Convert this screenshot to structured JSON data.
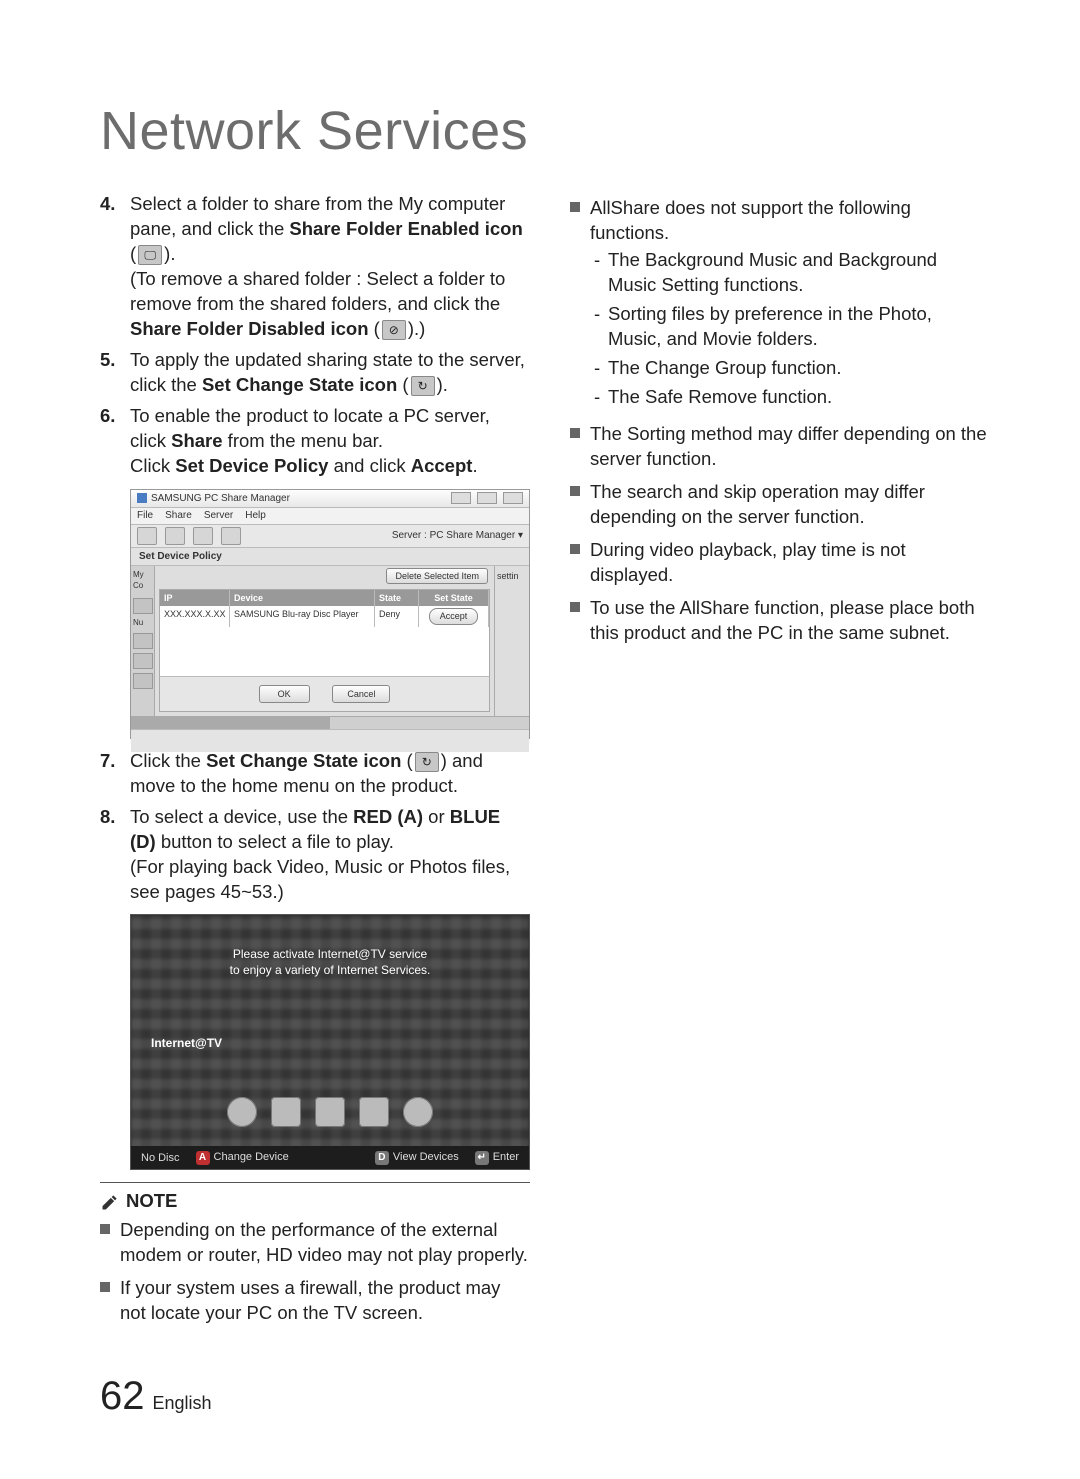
{
  "title": "Network Services",
  "steps": {
    "4": {
      "num": "4.",
      "text_a": "Select a folder to share from the My computer pane, and click the ",
      "bold_a": "Share Folder Enabled icon",
      "text_b": " (",
      "text_c": ").",
      "text_d": "(To remove a shared folder : Select a folder to remove from the shared folders, and click the ",
      "bold_b": "Share Folder Disabled icon",
      "text_e": " (",
      "text_f": ").)"
    },
    "5": {
      "num": "5.",
      "text_a": "To apply the updated sharing state to the server, click the ",
      "bold_a": "Set Change State icon",
      "text_b": " (",
      "text_c": ")."
    },
    "6": {
      "num": "6.",
      "text_a": "To enable the product to locate a PC server, click ",
      "bold_a": "Share",
      "text_b": " from the menu bar.",
      "text_c": "Click ",
      "bold_b": "Set Device Policy",
      "text_d": " and click ",
      "bold_c": "Accept",
      "text_e": "."
    },
    "7": {
      "num": "7.",
      "text_a": "Click the ",
      "bold_a": "Set Change State icon",
      "text_b": " (",
      "text_c": ") and move to the home menu on the product."
    },
    "8": {
      "num": "8.",
      "text_a": "To select a device, use the ",
      "bold_a": "RED (A)",
      "text_b": " or ",
      "bold_b": "BLUE (D)",
      "text_c": " button to select a file to play.",
      "text_d": "(For playing back Video, Music or Photos files, see pages 45~53.)"
    }
  },
  "window": {
    "title": "SAMSUNG PC Share Manager",
    "menus": [
      "File",
      "Share",
      "Server",
      "Help"
    ],
    "server_label": "Server : PC Share Manager ▾",
    "policy_label": "Set Device Policy",
    "myc_label": "My Co",
    "num_label": "Nu",
    "delete_btn": "Delete Selected Item",
    "headers": {
      "ip": "IP",
      "device": "Device",
      "state": "State",
      "set": "Set State"
    },
    "row": {
      "ip": "XXX.XXX.X.XX",
      "device": "SAMSUNG Blu-ray Disc Player",
      "state": "Deny",
      "btn": "Accept"
    },
    "settin": "settin",
    "ok": "OK",
    "cancel": "Cancel"
  },
  "tv": {
    "msg_line1": "Please activate Internet@TV service",
    "msg_line2": "to enjoy a variety of Internet Services.",
    "left": "Internet@TV",
    "bottom": {
      "nodisc": "No Disc",
      "a": "A",
      "change": "Change Device",
      "d": "D",
      "view": "View Devices",
      "enter_sym": "↵",
      "enter": "Enter"
    }
  },
  "note_heading": "NOTE",
  "notes_left": [
    "Depending on the performance of the external modem or router, HD video may not play properly.",
    "If your system uses a firewall, the product may not locate your PC on the TV screen."
  ],
  "right_col": {
    "allshare_intro": "AllShare does not support the following functions.",
    "allshare_items": [
      "The Background Music and Background Music Setting functions.",
      "Sorting files by preference in the Photo, Music, and Movie folders.",
      "The Change Group function.",
      "The Safe Remove function."
    ],
    "bullets": [
      "The Sorting method may differ depending on the server function.",
      "The search and skip operation may differ depending on the server function.",
      "During video playback, play time is not displayed.",
      "To use the AllShare function, please place both this product and the PC in the same subnet."
    ]
  },
  "footer": {
    "page": "62",
    "lang": "English"
  }
}
